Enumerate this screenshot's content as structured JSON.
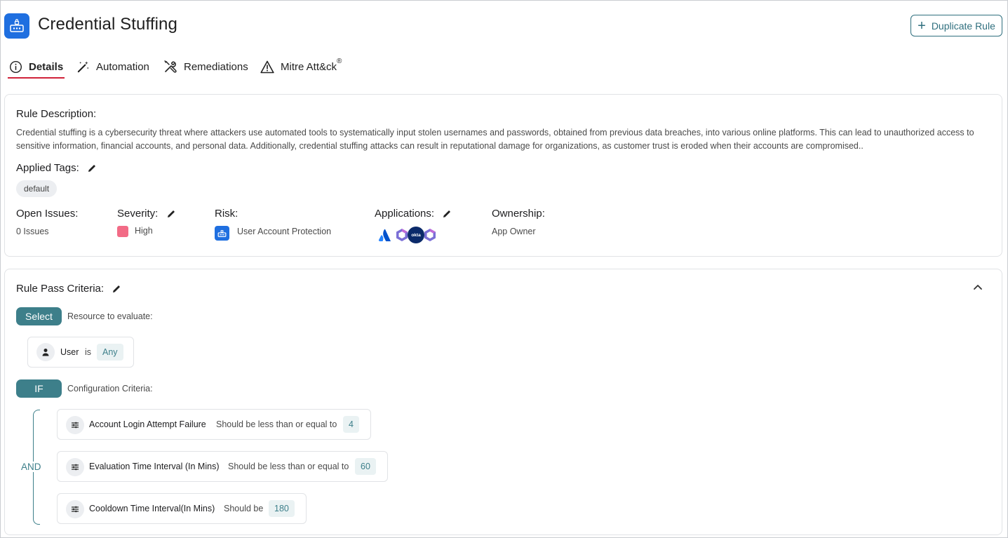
{
  "header": {
    "title": "Credential Stuffing",
    "duplicate_button": "Duplicate Rule"
  },
  "tabs": [
    {
      "label": "Details",
      "icon": "info-icon",
      "active": true
    },
    {
      "label": "Automation",
      "icon": "magic-wand-icon",
      "active": false
    },
    {
      "label": "Remediations",
      "icon": "tools-icon",
      "active": false
    },
    {
      "label": "Mitre Att&ck",
      "sup": "®",
      "icon": "warning-icon",
      "active": false
    }
  ],
  "details": {
    "description_label": "Rule Description:",
    "description": "Credential stuffing is a cybersecurity threat where attackers use automated tools to systematically input stolen usernames and passwords, obtained from previous data breaches, into various online platforms. This can lead to unauthorized access to sensitive information, financial accounts, and personal data. Additionally, credential stuffing attacks can result in reputational damage for organizations, as customer trust is eroded when their accounts are compromised..",
    "tags_label": "Applied Tags:",
    "tags": [
      "default"
    ],
    "open_issues_label": "Open Issues:",
    "open_issues_value": "0 Issues",
    "severity_label": "Severity:",
    "severity_value": "High",
    "severity_color": "#f26b86",
    "risk_label": "Risk:",
    "risk_value": "User Account Protection",
    "applications_label": "Applications:",
    "applications": [
      "atlassian-logo",
      "power-automate-logo",
      "okta-logo",
      "power-automate-logo"
    ],
    "okta_text": "okta",
    "ownership_label": "Ownership:",
    "ownership_value": "App Owner"
  },
  "criteria": {
    "title": "Rule Pass Criteria:",
    "select_label": "Select",
    "resource_label": "Resource to evaluate:",
    "resource": {
      "name": "User",
      "op": "is",
      "value": "Any"
    },
    "if_label": "IF",
    "config_label": "Configuration Criteria:",
    "and_label": "AND",
    "items": [
      {
        "name": "Account Login Attempt Failure",
        "op": "Should be less than or equal to",
        "value": "4"
      },
      {
        "name": "Evaluation Time Interval (In Mins)",
        "op": "Should be less than or equal to",
        "value": "60"
      },
      {
        "name": "Cooldown Time Interval(In Mins)",
        "op": "Should be",
        "value": "180"
      }
    ]
  },
  "colors": {
    "accent": "#3d7f8a",
    "brand_blue": "#1f6fe0",
    "tab_underline": "#d0223a"
  }
}
